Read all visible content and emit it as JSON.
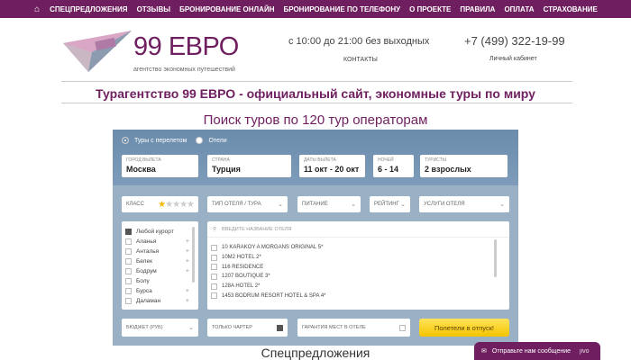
{
  "topnav": {
    "items": [
      "СПЕЦПРЕДЛОЖЕНИЯ",
      "ОТЗЫВЫ",
      "БРОНИРОВАНИЕ ОНЛАЙН",
      "БРОНИРОВАНИЕ ПО ТЕЛЕФОНУ",
      "О ПРОЕКТЕ",
      "ПРАВИЛА",
      "ОПЛАТА",
      "СТРАХОВАНИЕ"
    ]
  },
  "header": {
    "logo_text": "99 ЕВРО",
    "logo_sub": "агентство экономных путешествий",
    "hours": "с 10:00 до 21:00 без выходных",
    "contacts": "КОНТАКТЫ",
    "phone": "+7 (499) 322-19-99",
    "cabinet": "Личный кабинет"
  },
  "title": "Турагентство 99 ЕВРО - официальный сайт, экономные туры по миру",
  "subtitle": "Поиск туров по 120 тур операторам",
  "search": {
    "radio_flight": "Туры с перелетом",
    "radio_hotels": "Отели",
    "fields": [
      {
        "label": "ГОРОД ВЫЛЕТА",
        "value": "Москва"
      },
      {
        "label": "СТРАНА",
        "value": "Турция"
      },
      {
        "label": "ДАТЫ ВЫЛЕТА",
        "value": "11 окт - 20 окт"
      },
      {
        "label": "НОЧЕЙ",
        "value": "6 - 14"
      },
      {
        "label": "ТУРИСТЫ",
        "value": "2 взрослых"
      }
    ],
    "filters": {
      "class": "КЛАСС",
      "hotel_type": "ТИП ОТЕЛЯ / ТУРА",
      "food": "ПИТАНИЕ",
      "rating": "РЕЙТИНГ",
      "services": "УСЛУГИ ОТЕЛЯ"
    },
    "stars_filled": 1,
    "resorts": [
      "Любой курорт",
      "Аланья",
      "Анталья",
      "Белек",
      "Бодрум",
      "Болу",
      "Бурса",
      "Даламан"
    ],
    "hotel_search_placeholder": "ВВЕДИТЕ НАЗВАНИЕ ОТЕЛЯ",
    "hotels": [
      "10 KARAKOY A MORGANS ORIGINAL 5*",
      "10M2 HOTEL 2*",
      "116 RESIDENCE",
      "1207 BOUTIQUE 3*",
      "128A HOTEL 2*",
      "1453 BODRUM RESORT HOTEL & SPA 4*"
    ],
    "budget": "БЮДЖЕТ (РУБ)",
    "charter": "ТОЛЬКО ЧАРТЕР",
    "guarantee": "ГАРАНТИЯ МЕСТ В ОТЕЛЕ",
    "go_button": "Полетели в отпуск!"
  },
  "special": "Спецпредложения",
  "chat": "Отправьте нам сообщение",
  "chat_suffix": "jivo"
}
